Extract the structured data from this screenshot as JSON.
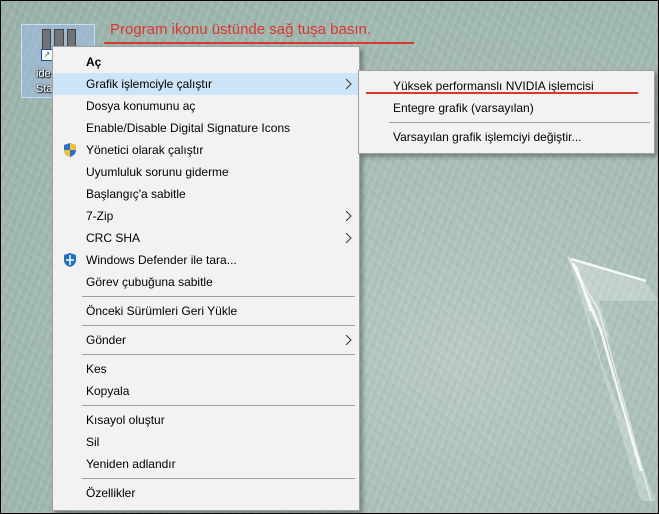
{
  "annotation": {
    "text": "Program ikonu üstünde sağ tuşa basın."
  },
  "desktop_icon": {
    "label_line1": "ide",
    "label_line2": "Sta"
  },
  "context_menu": {
    "open": "Aç",
    "run_with_gpu": "Grafik işlemciyle çalıştır",
    "open_location": "Dosya konumunu aç",
    "digital_signature": "Enable/Disable Digital Signature Icons",
    "run_as_admin": "Yönetici olarak çalıştır",
    "troubleshoot": "Uyumluluk sorunu giderme",
    "pin_start": "Başlangıç'a sabitle",
    "zip": "7-Zip",
    "crc": "CRC SHA",
    "defender": "Windows Defender ile tara...",
    "pin_taskbar": "Görev çubuğuna sabitle",
    "restore_versions": "Önceki Sürümleri Geri Yükle",
    "send_to": "Gönder",
    "cut": "Kes",
    "copy": "Kopyala",
    "create_shortcut": "Kısayol oluştur",
    "delete": "Sil",
    "rename": "Yeniden adlandır",
    "properties": "Özellikler"
  },
  "gpu_submenu": {
    "nvidia": "Yüksek performanslı NVIDIA işlemcisi",
    "integrated": "Entegre grafik (varsayılan)",
    "change_default": "Varsayılan grafik işlemciyi değiştir..."
  },
  "colors": {
    "annotation_red": "#d9382c",
    "highlight": "#cce4f7",
    "menu_bg": "#f2f2f2"
  }
}
